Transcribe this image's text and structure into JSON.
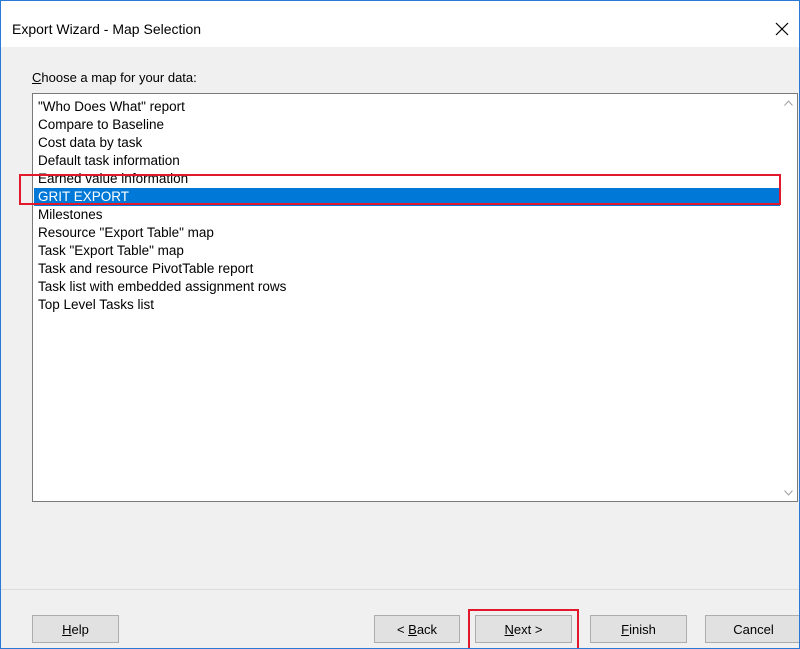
{
  "window": {
    "title": "Export Wizard - Map Selection",
    "close_icon": "close-icon"
  },
  "prompt": {
    "accel": "C",
    "rest": "hoose a map for your data:"
  },
  "maps": {
    "items": [
      "\"Who Does What\" report",
      "Compare to Baseline",
      "Cost data by task",
      "Default task information",
      "Earned value information",
      "GRIT EXPORT",
      "Milestones",
      "Resource \"Export Table\" map",
      "Task \"Export Table\" map",
      "Task and resource PivotTable report",
      "Task list with embedded assignment rows",
      "Top Level Tasks list"
    ],
    "selected": "GRIT EXPORT"
  },
  "buttons": {
    "help": {
      "accel": "H",
      "rest": "elp"
    },
    "back": {
      "pre": "< ",
      "accel": "B",
      "rest": "ack"
    },
    "next": {
      "accel": "N",
      "rest": "ext >"
    },
    "finish": {
      "accel": "F",
      "rest": "inish"
    },
    "cancel": {
      "label": "Cancel"
    }
  },
  "colors": {
    "selection": "#0078d7",
    "annotation": "#e2192b",
    "window_border": "#2b79d6"
  }
}
